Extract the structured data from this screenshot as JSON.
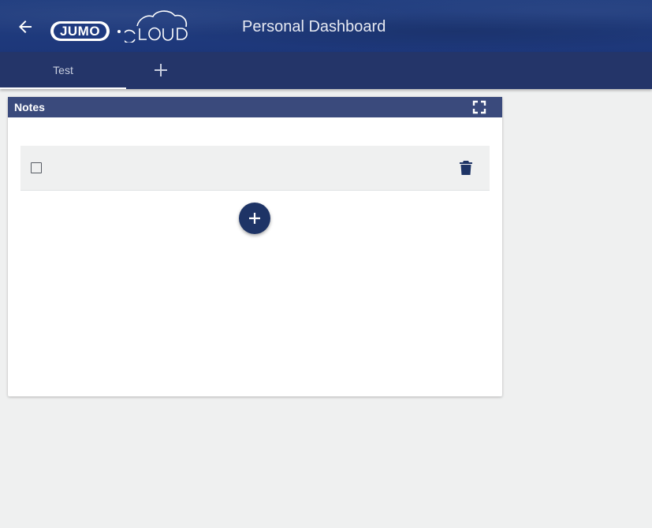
{
  "header": {
    "title": "Personal Dashboard",
    "logo": {
      "brand": "JUMO",
      "product": "CLOUD"
    },
    "back_icon": "arrow-left-icon"
  },
  "tabs": [
    {
      "label": "Test",
      "active": true
    }
  ],
  "tab_add_icon": "plus-icon",
  "widget": {
    "title": "Notes",
    "fullscreen_icon": "fullscreen-icon",
    "notes": [
      {
        "text": "",
        "checked": false,
        "delete_icon": "trash-icon"
      }
    ],
    "add_note_icon": "plus-icon"
  },
  "colors": {
    "header_bg": "#1f3a7a",
    "tabbar_bg": "#243569",
    "widget_header_bg": "#3a4a7c",
    "accent": "#1e3466",
    "page_bg": "#eff0f0"
  }
}
